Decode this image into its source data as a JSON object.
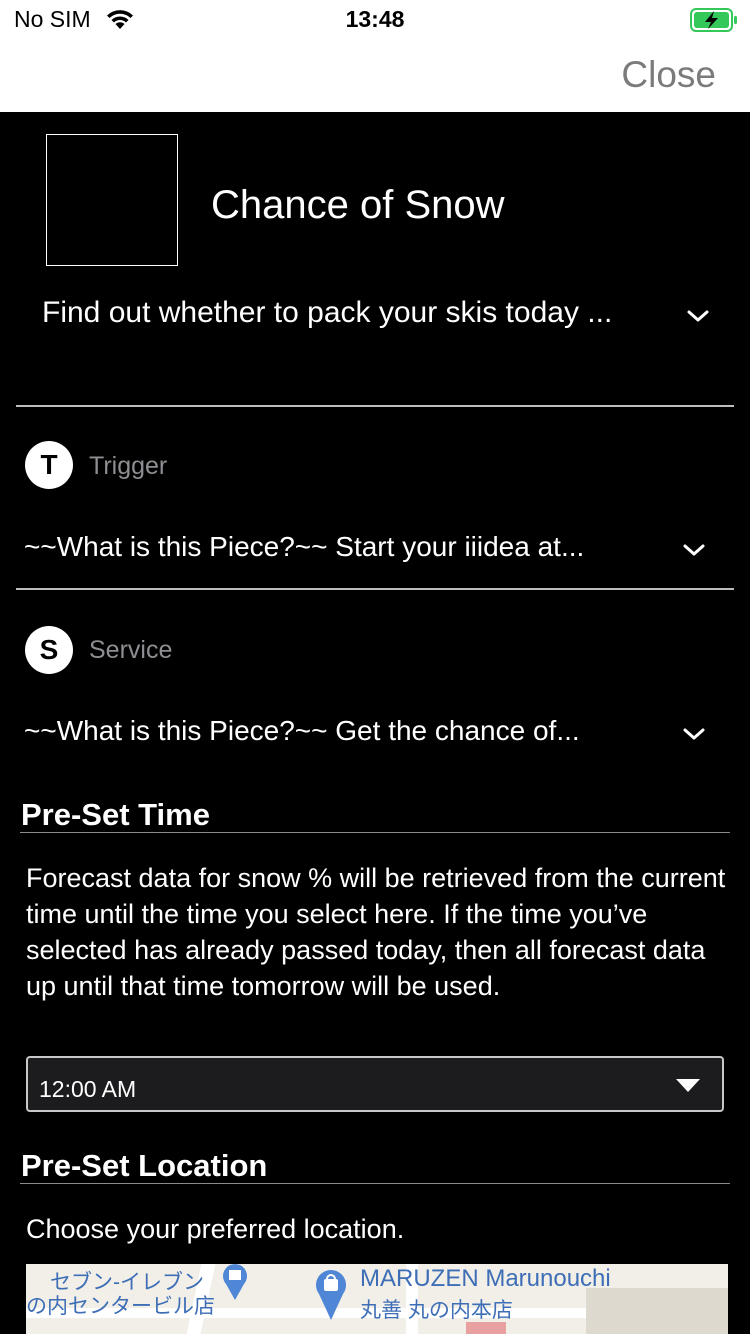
{
  "status_bar": {
    "carrier": "No SIM",
    "time": "13:48"
  },
  "nav": {
    "close_label": "Close"
  },
  "applet": {
    "title": "Chance of Snow",
    "description": "Find out whether to pack your skis today ..."
  },
  "trigger": {
    "badge": "T",
    "label": "Trigger",
    "summary": "~~What is this Piece?~~ Start your iiidea at..."
  },
  "service": {
    "badge": "S",
    "label": "Service",
    "summary": "~~What is this Piece?~~ Get the chance of..."
  },
  "preset_time": {
    "heading": "Pre-Set Time",
    "description": "Forecast data for snow % will be retrieved from the current time until the time you select here. If the time you’ve selected has already passed today, then all forecast data up until that time tomorrow will be used.",
    "selected_value": "12:00 AM"
  },
  "preset_location": {
    "heading": "Pre-Set Location",
    "description": "Choose your preferred location.",
    "map": {
      "label_store_jp": "セブン-イレブン",
      "label_store_jp2": "の内センタービル店",
      "label_maruzen": "MARUZEN Marunouchi",
      "label_maruzen_jp": "丸善 丸の内本店"
    }
  },
  "colors": {
    "background": "#000000",
    "header_background": "#ffffff",
    "close_gray": "#7b7b7b",
    "muted_label": "#8e8e93",
    "battery_green": "#34c759",
    "map_label_blue": "#3d6eb6"
  }
}
